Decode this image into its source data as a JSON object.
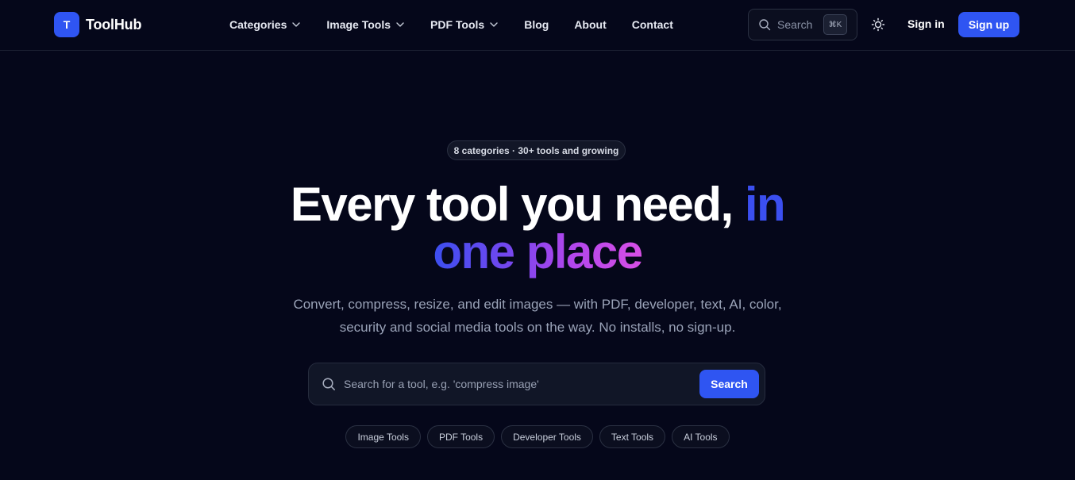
{
  "brand": {
    "logo_letter": "T",
    "name": "ToolHub",
    "accent_color": "#2f55f2"
  },
  "nav": {
    "items": [
      {
        "label": "Categories",
        "has_dropdown": true
      },
      {
        "label": "Image Tools",
        "has_dropdown": true
      },
      {
        "label": "PDF Tools",
        "has_dropdown": true
      },
      {
        "label": "Blog",
        "has_dropdown": false
      },
      {
        "label": "About",
        "has_dropdown": false
      },
      {
        "label": "Contact",
        "has_dropdown": false
      }
    ]
  },
  "header_search": {
    "label": "Search",
    "shortcut": "⌘K",
    "icon": "search-icon"
  },
  "theme_toggle": {
    "icon": "sun-icon"
  },
  "auth": {
    "signin_label": "Sign in",
    "signup_label": "Sign up"
  },
  "hero": {
    "badge": "8 categories · 30+ tools and growing",
    "title_part1": "Every tool you need,",
    "title_accent_1": "in",
    "title_accent_2": "one place",
    "subtitle_line1": "Convert, compress, resize, and edit images — with PDF, developer, text, AI, color,",
    "subtitle_line2": "security and social media tools on the way. No installs, no sign-up."
  },
  "main_search": {
    "placeholder": "Search for a tool, e.g. 'compress image'",
    "value": "",
    "button_label": "Search"
  },
  "quick_chips": [
    "Image Tools",
    "PDF Tools",
    "Developer Tools",
    "Text Tools",
    "AI Tools"
  ]
}
